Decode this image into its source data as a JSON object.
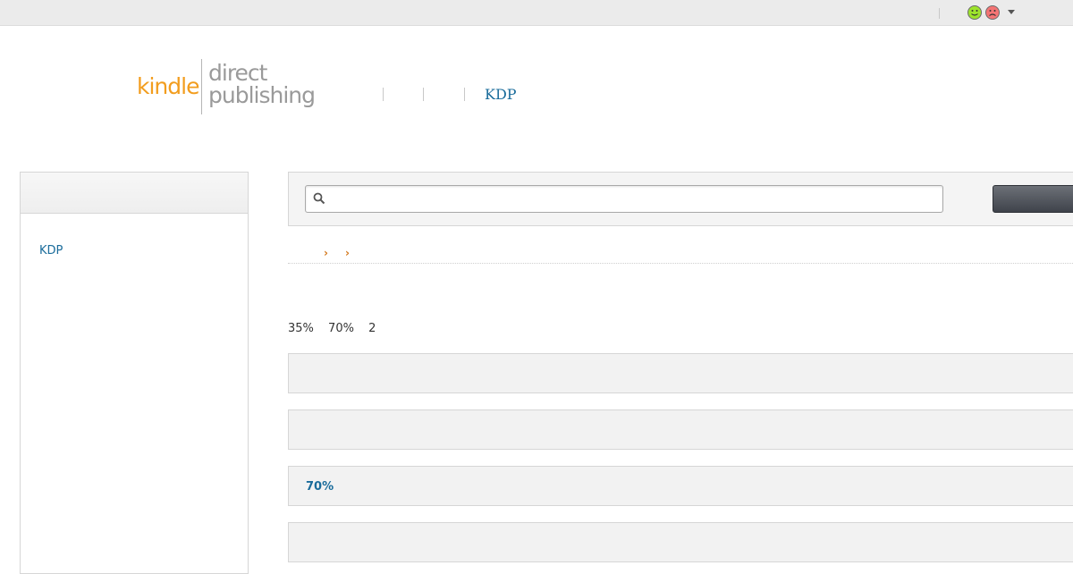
{
  "header": {
    "logo": {
      "kindle": "kindle",
      "direct": "direct",
      "publishing": "publishing"
    },
    "nav_link": "KDP"
  },
  "topbar": {
    "feedback_icons": [
      "smiley-happy-icon",
      "smiley-sad-icon"
    ],
    "menu_icon": "caret-down-icon"
  },
  "sidebar": {
    "link": "KDP"
  },
  "search": {
    "placeholder": "",
    "icon": "search-icon"
  },
  "breadcrumb": {
    "separators": [
      "›",
      "›"
    ]
  },
  "stats": [
    "35%",
    "70%",
    "2"
  ],
  "sections": [
    {
      "label": ""
    },
    {
      "label": ""
    },
    {
      "label": "70%"
    },
    {
      "label": ""
    }
  ],
  "colors": {
    "brand_orange": "#f29d1e",
    "link_blue": "#1a6c9b",
    "breadcrumb_orange": "#d3781c",
    "search_button": "#4a4e55"
  }
}
